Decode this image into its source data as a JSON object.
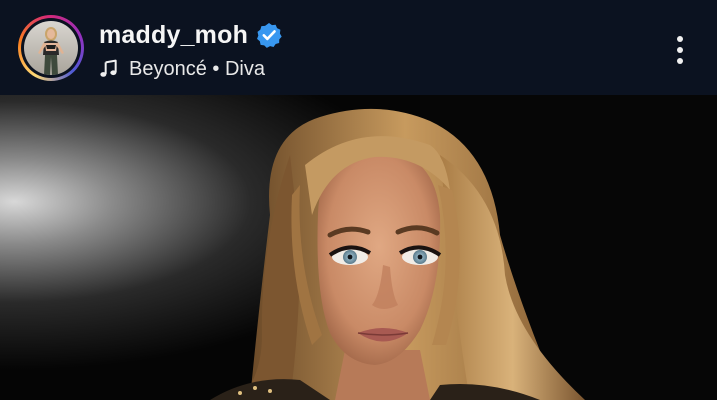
{
  "post_header": {
    "username": "maddy_moh",
    "verified": true,
    "audio_artist": "Beyoncé",
    "audio_separator": "•",
    "audio_track": "Diva",
    "audio_label": "Beyoncé • Diva"
  },
  "icons": {
    "verified": "verified-badge-icon",
    "music": "music-note-icon",
    "more": "more-vertical-icon"
  },
  "colors": {
    "header_bg": "#0b1220",
    "verified_blue": "#3897f0",
    "text": "#f5f5f5"
  }
}
